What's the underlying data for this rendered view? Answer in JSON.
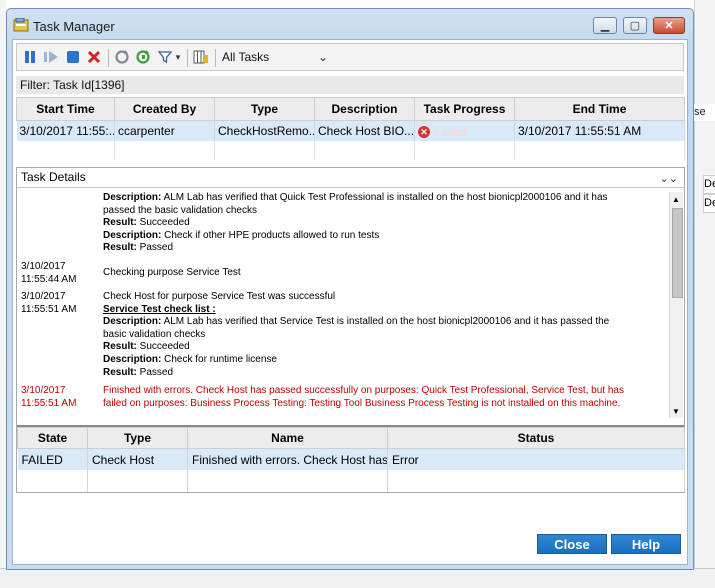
{
  "window": {
    "title": "Task Manager",
    "minimize_glyph": "▁",
    "maximize_glyph": "▢",
    "close_glyph": "✕"
  },
  "toolbar": {
    "icons": [
      "pause-icon",
      "resume-icon",
      "stop-icon",
      "delete-icon",
      "refresh-icon",
      "auto-refresh-icon",
      "filter-icon",
      "columns-icon"
    ],
    "filter_arrow": "▾",
    "task_filter_value": "All Tasks",
    "task_filter_arrow": "⌄"
  },
  "filter": {
    "text": "Filter: Task Id[1396]"
  },
  "tasks_table": {
    "columns": [
      "Start Time",
      "Created By",
      "Type",
      "Description",
      "Task Progress",
      "End Time"
    ],
    "rows": [
      {
        "start_time": "3/10/2017  11:55:...",
        "created_by": "ccarpenter",
        "type": "CheckHostRemo...",
        "description": "Check Host BIO...",
        "progress": "Failed",
        "end_time": "3/10/2017 11:55:51 AM"
      }
    ]
  },
  "details": {
    "title": "Task Details",
    "collapse_glyph": "⌄⌄",
    "log": [
      {
        "ts": "",
        "lines": [
          {
            "label": "Description:",
            "text": " ALM Lab has verified that Quick Test Professional is installed on the host bionicpl2000106 and it has"
          },
          {
            "label": "",
            "text": "passed the basic validation checks"
          },
          {
            "label": "Result:",
            "text": " Succeeded"
          },
          {
            "label": "Description:",
            "text": " Check if other HPE products allowed to run tests"
          },
          {
            "label": "Result:",
            "text": " Passed"
          }
        ]
      },
      {
        "ts_date": "3/10/2017",
        "ts_time": "11:55:44 AM",
        "lines": [
          {
            "label": "",
            "text": "Checking purpose Service Test"
          }
        ]
      },
      {
        "ts_date": "3/10/2017",
        "ts_time": "11:55:51 AM",
        "lines": [
          {
            "label": "",
            "text": "Check Host for purpose Service Test was successful"
          },
          {
            "label": "Service Test check list :",
            "text": ""
          },
          {
            "label": "Description:",
            "text": " ALM Lab has verified that Service Test is installed on the host bionicpl2000106 and it has passed the"
          },
          {
            "label": "",
            "text": "basic validation checks"
          },
          {
            "label": "Result:",
            "text": " Succeeded"
          },
          {
            "label": "Description:",
            "text": " Check for runtime license"
          },
          {
            "label": "Result:",
            "text": " Passed"
          }
        ]
      },
      {
        "ts_date": "3/10/2017",
        "ts_time": "11:55:51 AM",
        "error": true,
        "lines": [
          {
            "label": "",
            "text": "Finished with errors. Check Host has passed successfully on purposes: Quick Test Professional, Service Test, but has"
          },
          {
            "label": "",
            "text": "failed on purposes: Business Process Testing: Testing Tool Business Process Testing is not installed on this machine."
          }
        ]
      }
    ]
  },
  "status_table": {
    "columns": [
      "State",
      "Type",
      "Name",
      "Status"
    ],
    "rows": [
      {
        "state": "FAILED",
        "type": "Check Host",
        "name": "Finished with errors. Check Host has...",
        "status": "Error"
      }
    ]
  },
  "buttons": {
    "close": "Close",
    "help": "Help"
  },
  "background": {
    "right_text_1": "se",
    "right_text_2": "De",
    "right_text_3": "De"
  },
  "colors": {
    "accent_button": "#1f78c8",
    "selected_row": "#d9e9f7",
    "error_text": "#c00000"
  }
}
